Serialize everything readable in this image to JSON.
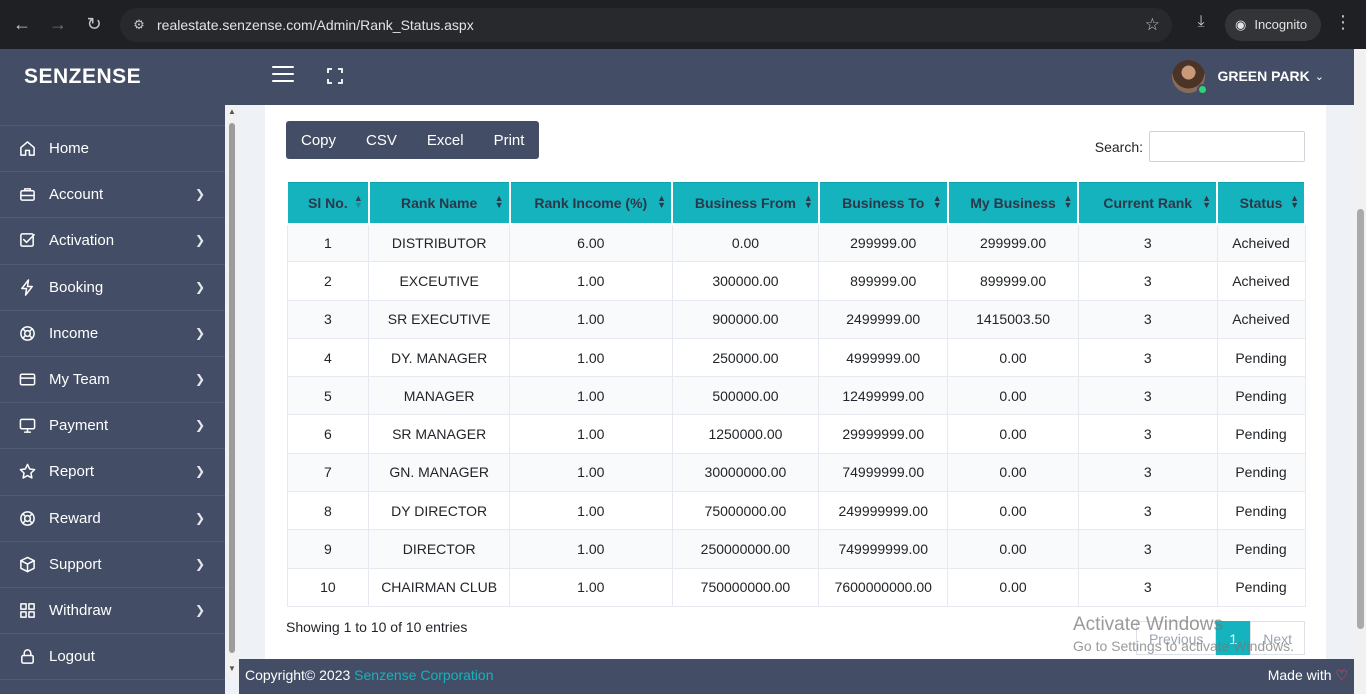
{
  "browser": {
    "url": "realestate.senzense.com/Admin/Rank_Status.aspx",
    "incognito_label": "Incognito"
  },
  "header": {
    "brand": "SENZENSE",
    "user_name": "GREEN PARK"
  },
  "sidebar": {
    "items": [
      {
        "label": "Home",
        "icon": "home-icon",
        "has_submenu": false
      },
      {
        "label": "Account",
        "icon": "briefcase-icon",
        "has_submenu": true
      },
      {
        "label": "Activation",
        "icon": "check-square-icon",
        "has_submenu": true
      },
      {
        "label": "Booking",
        "icon": "bolt-icon",
        "has_submenu": true
      },
      {
        "label": "Income",
        "icon": "lifebuoy-icon",
        "has_submenu": true
      },
      {
        "label": "My Team",
        "icon": "credit-card-icon",
        "has_submenu": true
      },
      {
        "label": "Payment",
        "icon": "monitor-icon",
        "has_submenu": true
      },
      {
        "label": "Report",
        "icon": "star-icon",
        "has_submenu": true
      },
      {
        "label": "Reward",
        "icon": "lifebuoy-icon",
        "has_submenu": true
      },
      {
        "label": "Support",
        "icon": "package-icon",
        "has_submenu": true
      },
      {
        "label": "Withdraw",
        "icon": "grid-icon",
        "has_submenu": true
      },
      {
        "label": "Logout",
        "icon": "lock-icon",
        "has_submenu": false
      }
    ]
  },
  "toolbar": {
    "copy": "Copy",
    "csv": "CSV",
    "excel": "Excel",
    "print": "Print",
    "search_label": "Search:",
    "search_value": ""
  },
  "table": {
    "columns": [
      "Sl No.",
      "Rank Name",
      "Rank Income (%)",
      "Business From",
      "Business To",
      "My Business",
      "Current Rank",
      "Status"
    ],
    "rows": [
      [
        "1",
        "DISTRIBUTOR",
        "6.00",
        "0.00",
        "299999.00",
        "299999.00",
        "3",
        "Acheived"
      ],
      [
        "2",
        "EXCEUTIVE",
        "1.00",
        "300000.00",
        "899999.00",
        "899999.00",
        "3",
        "Acheived"
      ],
      [
        "3",
        "SR EXECUTIVE",
        "1.00",
        "900000.00",
        "2499999.00",
        "1415003.50",
        "3",
        "Acheived"
      ],
      [
        "4",
        "DY. MANAGER",
        "1.00",
        "250000.00",
        "4999999.00",
        "0.00",
        "3",
        "Pending"
      ],
      [
        "5",
        "MANAGER",
        "1.00",
        "500000.00",
        "12499999.00",
        "0.00",
        "3",
        "Pending"
      ],
      [
        "6",
        "SR MANAGER",
        "1.00",
        "1250000.00",
        "29999999.00",
        "0.00",
        "3",
        "Pending"
      ],
      [
        "7",
        "GN. MANAGER",
        "1.00",
        "30000000.00",
        "74999999.00",
        "0.00",
        "3",
        "Pending"
      ],
      [
        "8",
        "DY DIRECTOR",
        "1.00",
        "75000000.00",
        "249999999.00",
        "0.00",
        "3",
        "Pending"
      ],
      [
        "9",
        "DIRECTOR",
        "1.00",
        "250000000.00",
        "749999999.00",
        "0.00",
        "3",
        "Pending"
      ],
      [
        "10",
        "CHAIRMAN CLUB",
        "1.00",
        "750000000.00",
        "7600000000.00",
        "0.00",
        "3",
        "Pending"
      ]
    ],
    "info": "Showing 1 to 10 of 10 entries"
  },
  "pagination": {
    "previous": "Previous",
    "current": "1",
    "next": "Next"
  },
  "footer": {
    "copyright": "Copyright© 2023",
    "company": "Senzense Corporation",
    "made_with": "Made with"
  },
  "watermark": {
    "title": "Activate Windows",
    "subtitle": "Go to Settings to activate Windows."
  },
  "colors": {
    "sidebar_bg": "#434d65",
    "accent": "#14b3be"
  }
}
